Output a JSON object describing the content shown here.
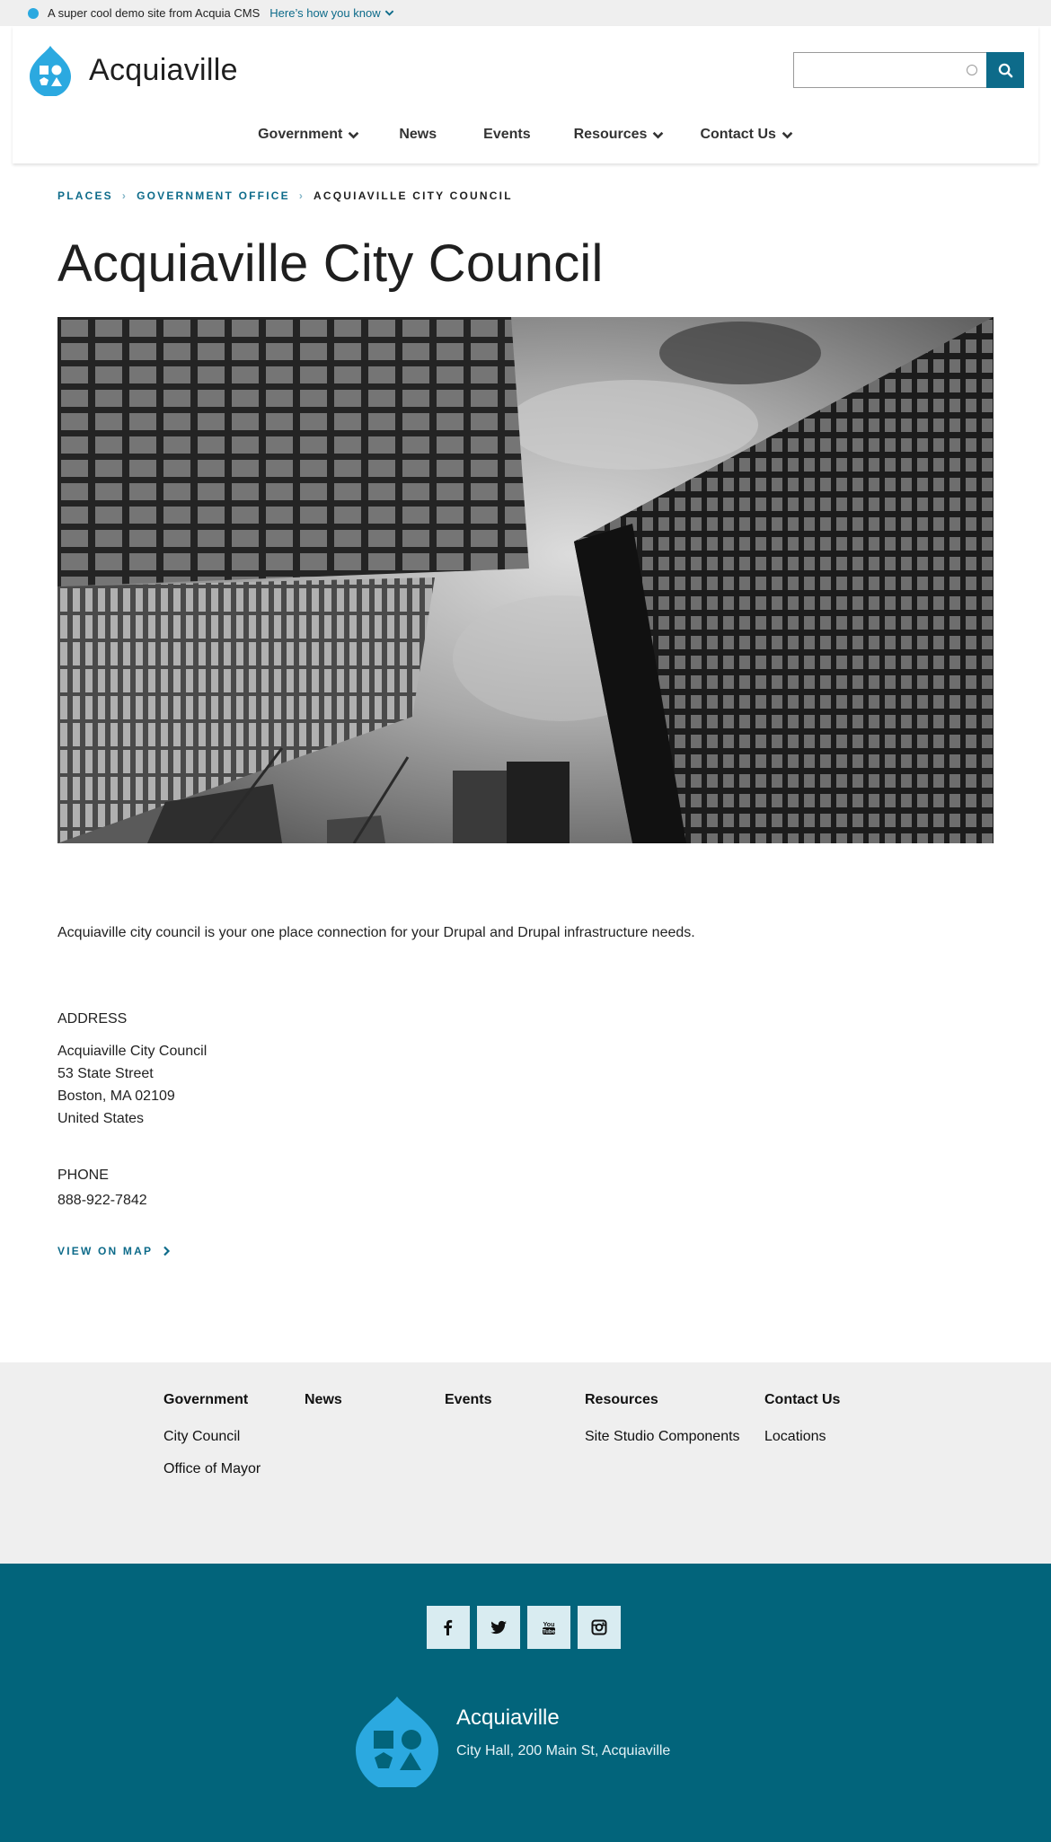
{
  "demo_bar": {
    "text": "A super cool demo site from Acquia CMS",
    "link": "Here’s how you know"
  },
  "header": {
    "site_name": "Acquiaville",
    "search_placeholder": ""
  },
  "nav": [
    {
      "label": "Government",
      "dropdown": true
    },
    {
      "label": "News",
      "dropdown": false
    },
    {
      "label": "Events",
      "dropdown": false
    },
    {
      "label": "Resources",
      "dropdown": true
    },
    {
      "label": "Contact Us",
      "dropdown": true
    }
  ],
  "breadcrumb": {
    "items": [
      "Places",
      "Government office"
    ],
    "current": "Acquiaville City Council"
  },
  "page": {
    "title": "Acquiaville City Council",
    "intro": "Acquiaville city council is your one place connection for your Drupal and Drupal infrastructure needs.",
    "address_label": "ADDRESS",
    "address_lines": [
      "Acquiaville City Council",
      "53 State Street",
      "Boston, MA 02109",
      "United States"
    ],
    "phone_label": "PHONE",
    "phone": "888-922-7842",
    "map_link": "VIEW ON MAP"
  },
  "footer_menu": [
    {
      "title": "Government",
      "links": [
        "City Council",
        "Office of Mayor"
      ]
    },
    {
      "title": "News",
      "links": []
    },
    {
      "title": "Events",
      "links": []
    },
    {
      "title": "Resources",
      "links": [
        "Site Studio Components"
      ]
    },
    {
      "title": "Contact Us",
      "links": [
        "Locations"
      ]
    }
  ],
  "footer": {
    "social": [
      "facebook-icon",
      "twitter-icon",
      "youtube-icon",
      "instagram-icon"
    ],
    "site_name": "Acquiaville",
    "address": "City Hall, 200 Main St, Acquiaville"
  },
  "colors": {
    "brand_blue": "#2ba9e0",
    "primary_teal": "#0d6b8a",
    "footer_teal": "#02647b",
    "light_gray": "#efefef"
  }
}
